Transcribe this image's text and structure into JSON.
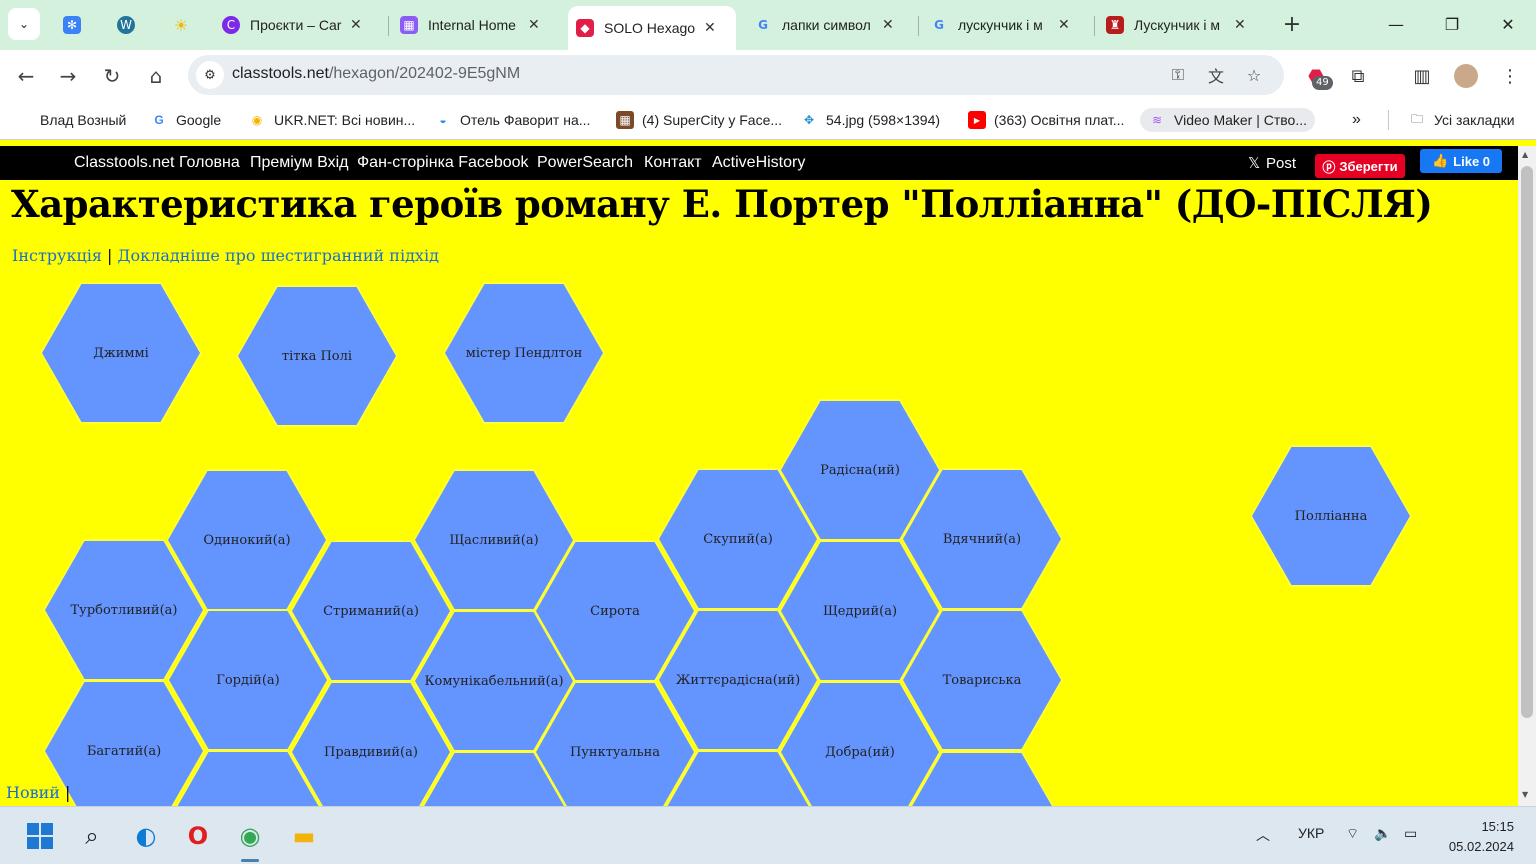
{
  "browser": {
    "tabs": [
      {
        "title": "",
        "favicon": "snowflake-icon",
        "color": "#3b82f6",
        "pinned": true
      },
      {
        "title": "",
        "favicon": "wordpress-icon",
        "color": "#21759b",
        "pinned": true
      },
      {
        "title": "",
        "favicon": "sun-icon",
        "color": "#f5b400",
        "pinned": true
      },
      {
        "title": "Проєкти – Car",
        "favicon": "canva-icon",
        "color": "#7d2ae8"
      },
      {
        "title": "Internal Home",
        "favicon": "calendar-icon",
        "color": "#8b5cf6"
      },
      {
        "title": "SOLO Hexagon",
        "favicon": "classtools-icon",
        "color": "#e11d48",
        "active": true
      },
      {
        "title": "лапки символ",
        "favicon": "google-icon",
        "color": "#4285f4"
      },
      {
        "title": "лускунчик і м",
        "favicon": "google-icon",
        "color": "#4285f4"
      },
      {
        "title": "Лускунчик і м",
        "favicon": "nutcracker-icon",
        "color": "#b91c1c"
      }
    ],
    "url_host": "classtools.net",
    "url_path": "/hexagon/202402-9E5gNM",
    "extension_badge": "49",
    "bookmarks": [
      {
        "label": "Влад Возный",
        "icon": ""
      },
      {
        "label": "Google",
        "icon": "google-icon"
      },
      {
        "label": "UKR.NET: Всі новин...",
        "icon": "ukrnet-icon"
      },
      {
        "label": "Отель Фаворит на...",
        "icon": "hotel-icon"
      },
      {
        "label": "(4) SuperCity у Face...",
        "icon": "supercity-icon"
      },
      {
        "label": "54.jpg (598×1394)",
        "icon": "image-icon"
      },
      {
        "label": "(363) Освітня плат...",
        "icon": "youtube-icon"
      },
      {
        "label": "Video Maker | Ство...",
        "icon": "videomaker-icon"
      }
    ],
    "all_bookmarks": "Усі закладки"
  },
  "site_nav": {
    "links": [
      "Classtools.net Головна",
      "Преміум Вхід",
      "Фан-сторінка Facebook",
      "PowerSearch",
      "Контакт",
      "ActiveHistory"
    ],
    "post": "Post",
    "save": "Зберегти",
    "like": "Like 0"
  },
  "page": {
    "title": "Характеристика героїв роману Е. Портер \"Полліанна\" (ДО-ПІСЛЯ)",
    "link_instructions": "Інструкція",
    "separator": "|",
    "link_about": "Докладніше про шестигранний підхід",
    "footer_link": "Новий",
    "footer_sep": "|"
  },
  "hexagons": [
    "Джиммі",
    "тітка Полі",
    "містер Пендлтон",
    "Радісна(ий)",
    "Полліанна",
    "Одинокий(а)",
    "Щасливий(а)",
    "Скупий(а)",
    "Вдячний(а)",
    "Турботливий(а)",
    "Стриманий(а)",
    "Сирота",
    "Щедрий(а)",
    "Гордій(а)",
    "Комунікабельний(а)",
    "Життєрадісна(ий)",
    "Товариська",
    "Багатий(а)",
    "Правдивий(а)",
    "Пунктуальна",
    "Добра(ий)",
    "",
    "",
    "",
    ""
  ],
  "taskbar": {
    "language": "УКР",
    "time": "15:15",
    "date": "05.02.2024"
  }
}
